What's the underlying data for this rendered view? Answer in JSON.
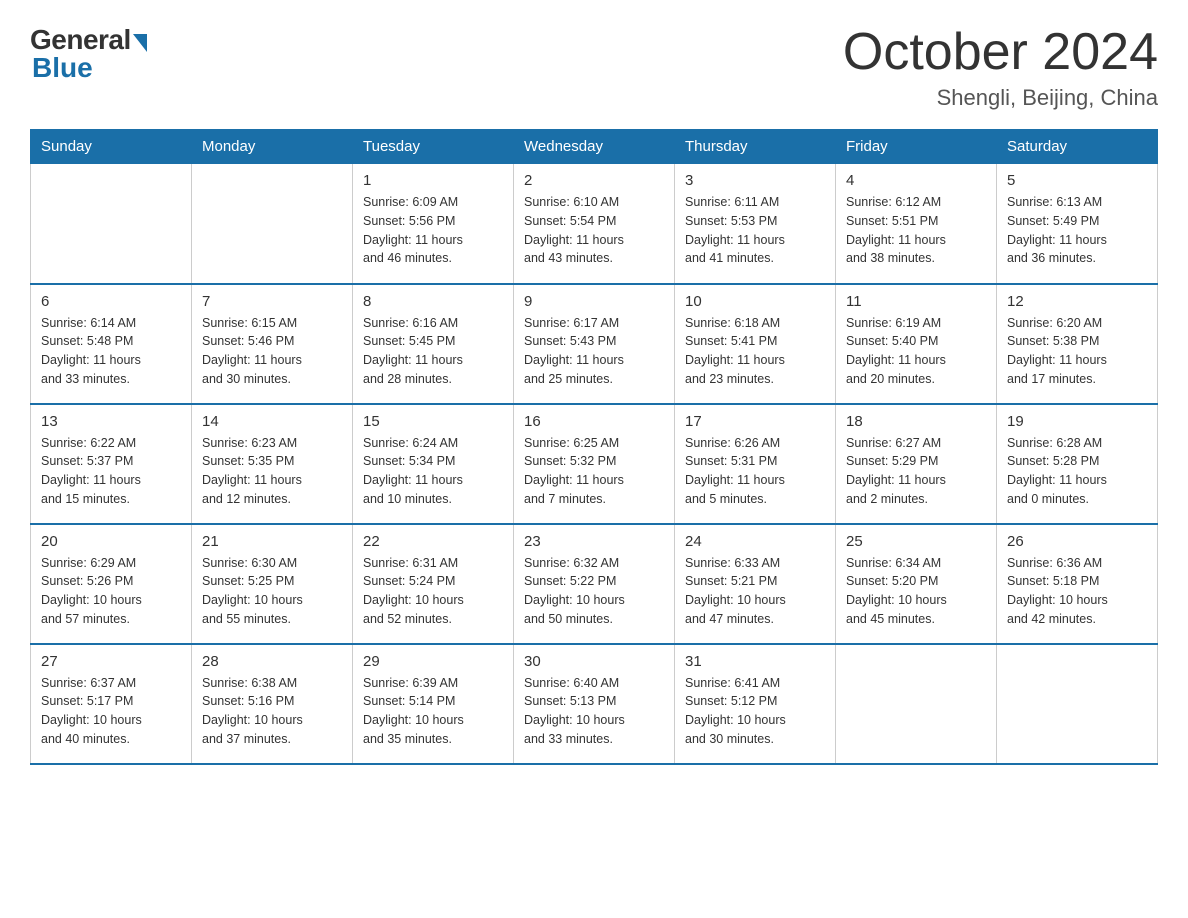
{
  "logo": {
    "general": "General",
    "blue": "Blue"
  },
  "title": "October 2024",
  "subtitle": "Shengli, Beijing, China",
  "headers": [
    "Sunday",
    "Monday",
    "Tuesday",
    "Wednesday",
    "Thursday",
    "Friday",
    "Saturday"
  ],
  "weeks": [
    [
      {
        "day": "",
        "info": ""
      },
      {
        "day": "",
        "info": ""
      },
      {
        "day": "1",
        "info": "Sunrise: 6:09 AM\nSunset: 5:56 PM\nDaylight: 11 hours\nand 46 minutes."
      },
      {
        "day": "2",
        "info": "Sunrise: 6:10 AM\nSunset: 5:54 PM\nDaylight: 11 hours\nand 43 minutes."
      },
      {
        "day": "3",
        "info": "Sunrise: 6:11 AM\nSunset: 5:53 PM\nDaylight: 11 hours\nand 41 minutes."
      },
      {
        "day": "4",
        "info": "Sunrise: 6:12 AM\nSunset: 5:51 PM\nDaylight: 11 hours\nand 38 minutes."
      },
      {
        "day": "5",
        "info": "Sunrise: 6:13 AM\nSunset: 5:49 PM\nDaylight: 11 hours\nand 36 minutes."
      }
    ],
    [
      {
        "day": "6",
        "info": "Sunrise: 6:14 AM\nSunset: 5:48 PM\nDaylight: 11 hours\nand 33 minutes."
      },
      {
        "day": "7",
        "info": "Sunrise: 6:15 AM\nSunset: 5:46 PM\nDaylight: 11 hours\nand 30 minutes."
      },
      {
        "day": "8",
        "info": "Sunrise: 6:16 AM\nSunset: 5:45 PM\nDaylight: 11 hours\nand 28 minutes."
      },
      {
        "day": "9",
        "info": "Sunrise: 6:17 AM\nSunset: 5:43 PM\nDaylight: 11 hours\nand 25 minutes."
      },
      {
        "day": "10",
        "info": "Sunrise: 6:18 AM\nSunset: 5:41 PM\nDaylight: 11 hours\nand 23 minutes."
      },
      {
        "day": "11",
        "info": "Sunrise: 6:19 AM\nSunset: 5:40 PM\nDaylight: 11 hours\nand 20 minutes."
      },
      {
        "day": "12",
        "info": "Sunrise: 6:20 AM\nSunset: 5:38 PM\nDaylight: 11 hours\nand 17 minutes."
      }
    ],
    [
      {
        "day": "13",
        "info": "Sunrise: 6:22 AM\nSunset: 5:37 PM\nDaylight: 11 hours\nand 15 minutes."
      },
      {
        "day": "14",
        "info": "Sunrise: 6:23 AM\nSunset: 5:35 PM\nDaylight: 11 hours\nand 12 minutes."
      },
      {
        "day": "15",
        "info": "Sunrise: 6:24 AM\nSunset: 5:34 PM\nDaylight: 11 hours\nand 10 minutes."
      },
      {
        "day": "16",
        "info": "Sunrise: 6:25 AM\nSunset: 5:32 PM\nDaylight: 11 hours\nand 7 minutes."
      },
      {
        "day": "17",
        "info": "Sunrise: 6:26 AM\nSunset: 5:31 PM\nDaylight: 11 hours\nand 5 minutes."
      },
      {
        "day": "18",
        "info": "Sunrise: 6:27 AM\nSunset: 5:29 PM\nDaylight: 11 hours\nand 2 minutes."
      },
      {
        "day": "19",
        "info": "Sunrise: 6:28 AM\nSunset: 5:28 PM\nDaylight: 11 hours\nand 0 minutes."
      }
    ],
    [
      {
        "day": "20",
        "info": "Sunrise: 6:29 AM\nSunset: 5:26 PM\nDaylight: 10 hours\nand 57 minutes."
      },
      {
        "day": "21",
        "info": "Sunrise: 6:30 AM\nSunset: 5:25 PM\nDaylight: 10 hours\nand 55 minutes."
      },
      {
        "day": "22",
        "info": "Sunrise: 6:31 AM\nSunset: 5:24 PM\nDaylight: 10 hours\nand 52 minutes."
      },
      {
        "day": "23",
        "info": "Sunrise: 6:32 AM\nSunset: 5:22 PM\nDaylight: 10 hours\nand 50 minutes."
      },
      {
        "day": "24",
        "info": "Sunrise: 6:33 AM\nSunset: 5:21 PM\nDaylight: 10 hours\nand 47 minutes."
      },
      {
        "day": "25",
        "info": "Sunrise: 6:34 AM\nSunset: 5:20 PM\nDaylight: 10 hours\nand 45 minutes."
      },
      {
        "day": "26",
        "info": "Sunrise: 6:36 AM\nSunset: 5:18 PM\nDaylight: 10 hours\nand 42 minutes."
      }
    ],
    [
      {
        "day": "27",
        "info": "Sunrise: 6:37 AM\nSunset: 5:17 PM\nDaylight: 10 hours\nand 40 minutes."
      },
      {
        "day": "28",
        "info": "Sunrise: 6:38 AM\nSunset: 5:16 PM\nDaylight: 10 hours\nand 37 minutes."
      },
      {
        "day": "29",
        "info": "Sunrise: 6:39 AM\nSunset: 5:14 PM\nDaylight: 10 hours\nand 35 minutes."
      },
      {
        "day": "30",
        "info": "Sunrise: 6:40 AM\nSunset: 5:13 PM\nDaylight: 10 hours\nand 33 minutes."
      },
      {
        "day": "31",
        "info": "Sunrise: 6:41 AM\nSunset: 5:12 PM\nDaylight: 10 hours\nand 30 minutes."
      },
      {
        "day": "",
        "info": ""
      },
      {
        "day": "",
        "info": ""
      }
    ]
  ]
}
